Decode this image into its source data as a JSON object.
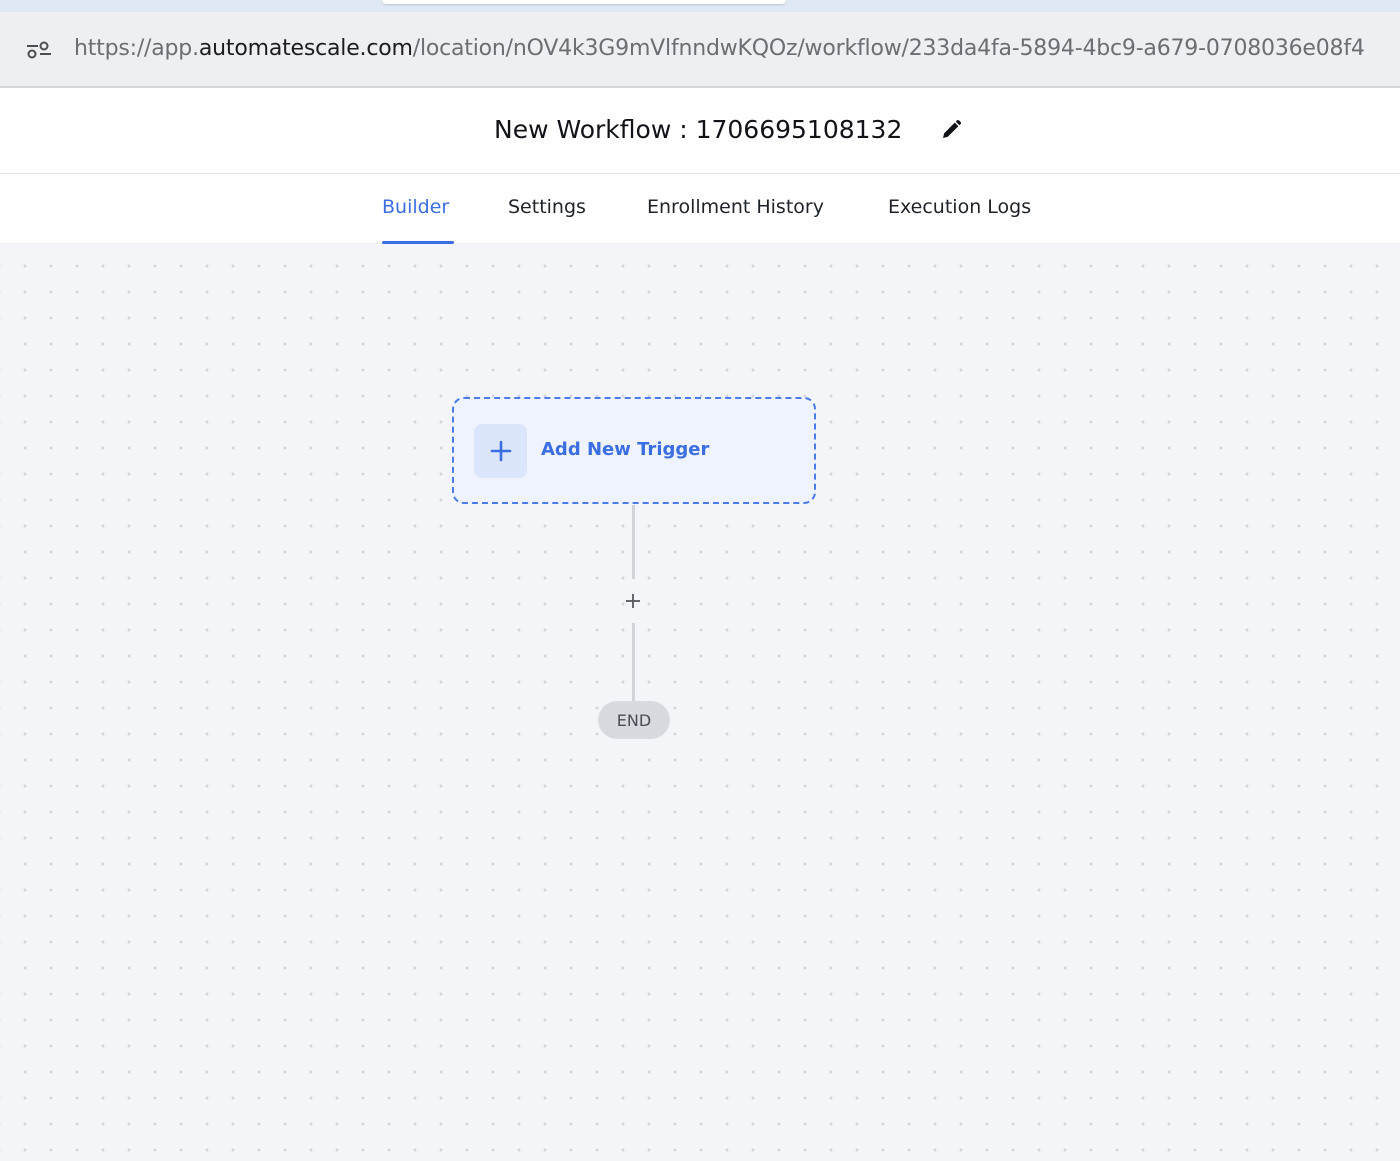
{
  "browser": {
    "url_prefix": "https://app.",
    "url_domain": "automatescale.com",
    "url_path": "/location/nOV4k3G9mVlfnndwKQOz/workflow/233da4fa-5894-4bc9-a679-0708036e08f4"
  },
  "header": {
    "workflow_title": "New Workflow : 1706695108132"
  },
  "tabs": [
    {
      "label": "Builder",
      "active": true
    },
    {
      "label": "Settings",
      "active": false
    },
    {
      "label": "Enrollment History",
      "active": false
    },
    {
      "label": "Execution Logs",
      "active": false
    }
  ],
  "canvas": {
    "trigger_label": "Add New Trigger",
    "add_step_symbol": "+",
    "end_label": "END"
  },
  "icons": {
    "site_settings": "site-settings-icon",
    "edit": "pencil-icon",
    "trigger_plus": "plus-icon",
    "add_step": "plus-icon"
  },
  "colors": {
    "accent": "#3b6ee0",
    "trigger_bg": "#eef3fe",
    "end_bg": "#d8dadf"
  }
}
